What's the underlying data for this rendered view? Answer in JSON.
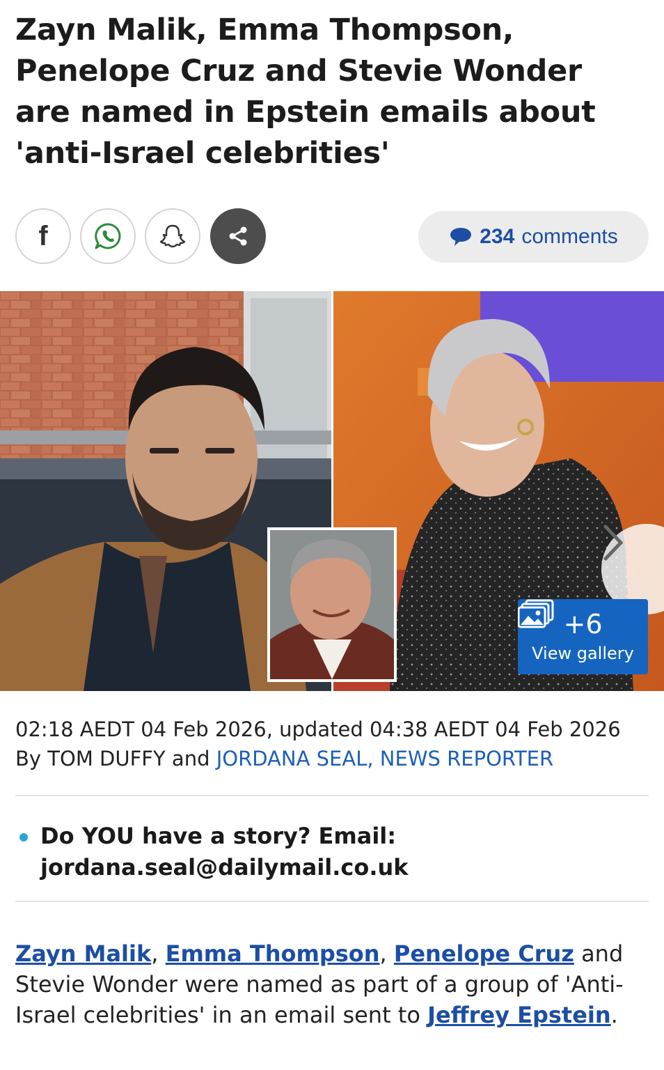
{
  "article": {
    "headline": "Zayn Malik, Emma Thompson, Penelope Cruz and Stevie Wonder are named in Epstein emails about 'anti-Israel celebrities'",
    "share": {
      "facebook_glyph": "f",
      "icons": [
        "facebook-icon",
        "whatsapp-icon",
        "snapchat-icon",
        "share-icon"
      ]
    },
    "comments": {
      "count": "234",
      "label": "comments",
      "icon": "speech-bubble-icon"
    },
    "gallery": {
      "count": "+6",
      "label": "View gallery",
      "icon": "gallery-icon"
    },
    "timestamp": "02:18 AEDT 04 Feb 2026, updated 04:38 AEDT 04 Feb 2026",
    "byline": {
      "prefix": "By",
      "author1": "TOM DUFFY",
      "joiner": "and",
      "author2": "JORDANA SEAL, NEWS REPORTER"
    },
    "story_prompt": {
      "line1": "Do YOU have a story? Email:",
      "email": "jordana.seal@dailymail.co.uk"
    },
    "body": {
      "link1": "Zayn Malik",
      "sep1": ", ",
      "link2": "Emma Thompson",
      "sep2": ", ",
      "link3": "Penelope Cruz",
      "text1": " and Stevie Wonder were named as part of a group of 'Anti-Israel celebrities' in an email sent to ",
      "link4": "Jeffrey Epstein",
      "end": "."
    }
  },
  "colors": {
    "link_blue": "#1d4ea3",
    "byline_blue": "#1d5fb8",
    "gallery_blue": "#1565c0",
    "bullet_blue": "#2aa3d8",
    "share_dark": "#4d4d4d"
  }
}
